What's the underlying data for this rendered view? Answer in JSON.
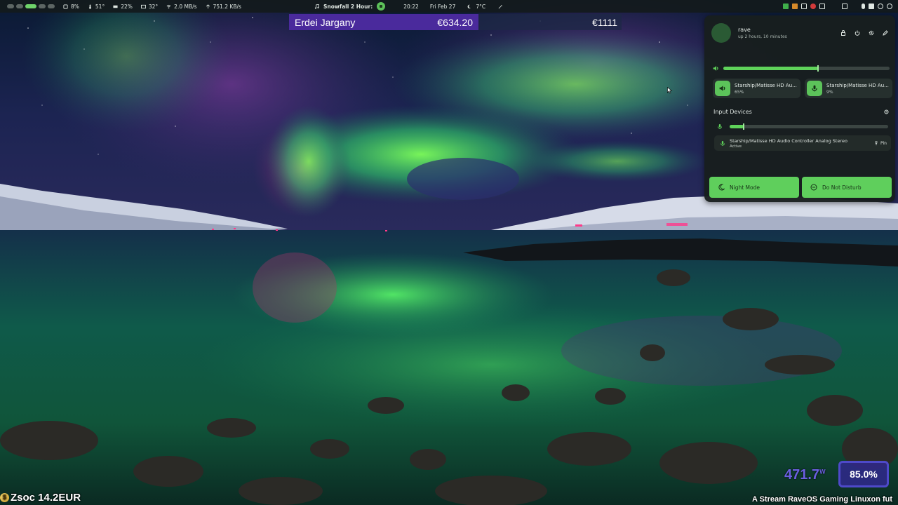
{
  "topbar": {
    "workspaces": [
      {
        "id": 1,
        "active": false
      },
      {
        "id": 2,
        "active": false
      },
      {
        "id": 3,
        "active": true
      },
      {
        "id": 4,
        "active": false
      },
      {
        "id": 5,
        "active": false
      }
    ],
    "cpu": "8%",
    "temp": "51°",
    "mem": "22%",
    "gpu_temp": "32°",
    "net_down": "2.0 MB/s",
    "net_up": "751.2 KB/s",
    "media_title": "Snowfall 2 Hour:",
    "time": "20:22",
    "date": "Fri Feb 27",
    "weather": "7°C"
  },
  "ticker": {
    "name": "Erdei Jargany",
    "amount": "€634.20",
    "goal": "€1111"
  },
  "panel": {
    "user": {
      "name": "rave",
      "uptime": "up 2 hours, 10 minutes"
    },
    "output_volume": 0.57,
    "output_device": {
      "name": "Starship/Matisse HD Au...",
      "level": "65%"
    },
    "input_device_quick": {
      "name": "Starship/Matisse HD Au...",
      "level": "9%"
    },
    "input_section_title": "Input Devices",
    "input_volume": 0.09,
    "input_device": {
      "name": "Starship/Matisse HD Audio Controller Analog Stereo",
      "status": "Active",
      "pin_label": "Pin"
    },
    "toggles": {
      "night_mode": "Night Mode",
      "do_not_disturb": "Do Not Disturb"
    }
  },
  "overlay": {
    "zsoc": "Zsoc 14.2EUR",
    "power_value": "471.7",
    "power_unit": "W",
    "percent": "85.0%",
    "stream_title": "A Stream RaveOS Gaming Linuxon fut"
  },
  "colors": {
    "accent_green": "#5fd35a",
    "ticker_purple": "#4a2a9c",
    "overlay_purple": "#4e49c9"
  }
}
